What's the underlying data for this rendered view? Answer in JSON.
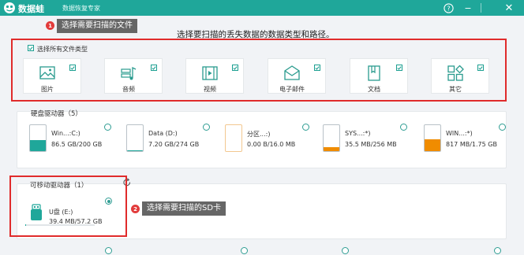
{
  "app": {
    "name": "数据蛙",
    "subtitle": "数据恢复专家",
    "colors": {
      "brand": "#1fa79a",
      "annotation": "#e02b2b",
      "warning": "#f08c00"
    }
  },
  "window_controls": {
    "help": "?",
    "minimize": "−",
    "close": "✕"
  },
  "annotations": [
    {
      "number": "1",
      "text": "选择需要扫描的文件"
    },
    {
      "number": "2",
      "text": "选择需要扫描的SD卡"
    }
  ],
  "section_title": "选择要扫描的丢失数据的数据类型和路径。",
  "file_types": {
    "select_all_label": "选择所有文件类型",
    "select_all_checked": true,
    "items": [
      {
        "label": "图片",
        "icon": "image-icon",
        "checked": true
      },
      {
        "label": "音频",
        "icon": "music-icon",
        "checked": true
      },
      {
        "label": "视频",
        "icon": "video-icon",
        "checked": true
      },
      {
        "label": "电子邮件",
        "icon": "email-icon",
        "checked": true
      },
      {
        "label": "文档",
        "icon": "document-icon",
        "checked": true
      },
      {
        "label": "其它",
        "icon": "other-icon",
        "checked": true
      }
    ]
  },
  "hard_drives": {
    "title": "硬盘驱动器（5）",
    "items": [
      {
        "name": "Win...:C:)",
        "size": "86.5 GB/200 GB",
        "used_fraction": 0.43,
        "fill_color": "#1fa79a",
        "selected": false
      },
      {
        "name": "Data (D:)",
        "size": "7.20 GB/274 GB",
        "used_fraction": 0.03,
        "fill_color": "#1fa79a",
        "selected": false
      },
      {
        "name": "分区...:)",
        "size": "0.00  B/16.0 MB",
        "used_fraction": 0.0,
        "fill_color": "#f7c98b",
        "selected": false
      },
      {
        "name": "SYS...:*)",
        "size": "35.5 MB/256 MB",
        "used_fraction": 0.14,
        "fill_color": "#f08c00",
        "selected": false
      },
      {
        "name": "WIN...:*)",
        "size": "817 MB/1.75 GB",
        "used_fraction": 0.47,
        "fill_color": "#f08c00",
        "selected": false
      }
    ]
  },
  "removable_drives": {
    "title": "可移动驱动器（1）",
    "items": [
      {
        "name": "U盘 (E:)",
        "size": "39.4 MB/57.2 GB",
        "used_fraction": 0.001,
        "selected": true
      }
    ]
  }
}
